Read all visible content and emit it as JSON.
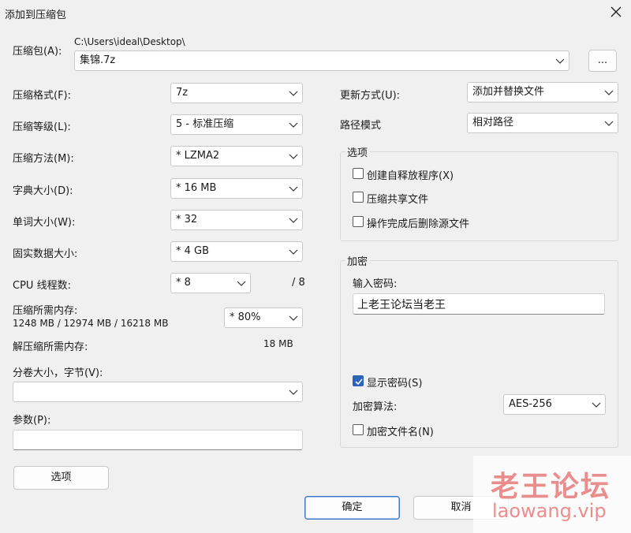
{
  "window": {
    "title": "添加到压缩包"
  },
  "archive": {
    "label": "压缩包(A):",
    "path": "C:\\Users\\ideal\\Desktop\\",
    "name": "集锦.7z",
    "browse_label": "..."
  },
  "left": {
    "format": {
      "label": "压缩格式(F):",
      "value": "7z"
    },
    "level": {
      "label": "压缩等级(L):",
      "value": "5 - 标准压缩"
    },
    "method": {
      "label": "压缩方法(M):",
      "value": "* LZMA2"
    },
    "dict": {
      "label": "字典大小(D):",
      "value": "* 16 MB"
    },
    "word": {
      "label": "单词大小(W):",
      "value": "* 32"
    },
    "solid": {
      "label": "固实数据大小:",
      "value": "* 4 GB"
    },
    "threads": {
      "label": "CPU 线程数:",
      "value": "* 8",
      "max": "/ 8"
    },
    "mem": {
      "label": "压缩所需内存:",
      "detail": "1248 MB / 12974 MB / 16218 MB",
      "value": "* 80%"
    },
    "decomp": {
      "label": "解压缩所需内存:",
      "value": "18 MB"
    },
    "volume": {
      "label": "分卷大小，字节(V):",
      "value": ""
    },
    "params": {
      "label": "参数(P):",
      "value": ""
    },
    "options_button": "选项"
  },
  "right": {
    "update": {
      "label": "更新方式(U):",
      "value": "添加并替换文件"
    },
    "pathmode": {
      "label": "路径模式",
      "value": "相对路径"
    },
    "options": {
      "title": "选项",
      "sfx": "创建自释放程序(X)",
      "shared": "压缩共享文件",
      "delete": "操作完成后删除源文件"
    },
    "encryption": {
      "title": "加密",
      "password_label": "输入密码:",
      "password": "上老王论坛当老王",
      "show_password": "显示密码(S)",
      "algo_label": "加密算法:",
      "algo": "AES-256",
      "encrypt_names": "加密文件名(N)"
    }
  },
  "footer": {
    "ok": "确定",
    "cancel": "取消"
  },
  "watermark": {
    "line1": "老王论坛",
    "line2": "laowang.vip"
  }
}
